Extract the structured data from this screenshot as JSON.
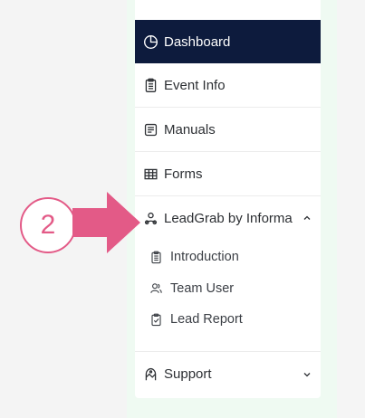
{
  "sidebar": {
    "items": [
      {
        "label": "Dashboard",
        "icon": "pie-chart-icon",
        "active": true
      },
      {
        "label": "Event Info",
        "icon": "clipboard-icon"
      },
      {
        "label": "Manuals",
        "icon": "document-icon"
      },
      {
        "label": "Forms",
        "icon": "table-icon"
      },
      {
        "label": "LeadGrab by Informa",
        "icon": "users-icon",
        "expanded": true,
        "children": [
          {
            "label": "Introduction",
            "icon": "list-doc-icon"
          },
          {
            "label": "Team User",
            "icon": "user-group-icon"
          },
          {
            "label": "Lead Report",
            "icon": "checklist-icon"
          }
        ]
      },
      {
        "label": "Support",
        "icon": "support-icon"
      }
    ]
  },
  "annotation": {
    "step_number": "2",
    "accent_color": "#e35a87"
  },
  "colors": {
    "active_bg": "#0d1b3d",
    "text": "#2c2f33",
    "page_bg": "#f4f4f4",
    "strip_bg": "#effaf2"
  }
}
